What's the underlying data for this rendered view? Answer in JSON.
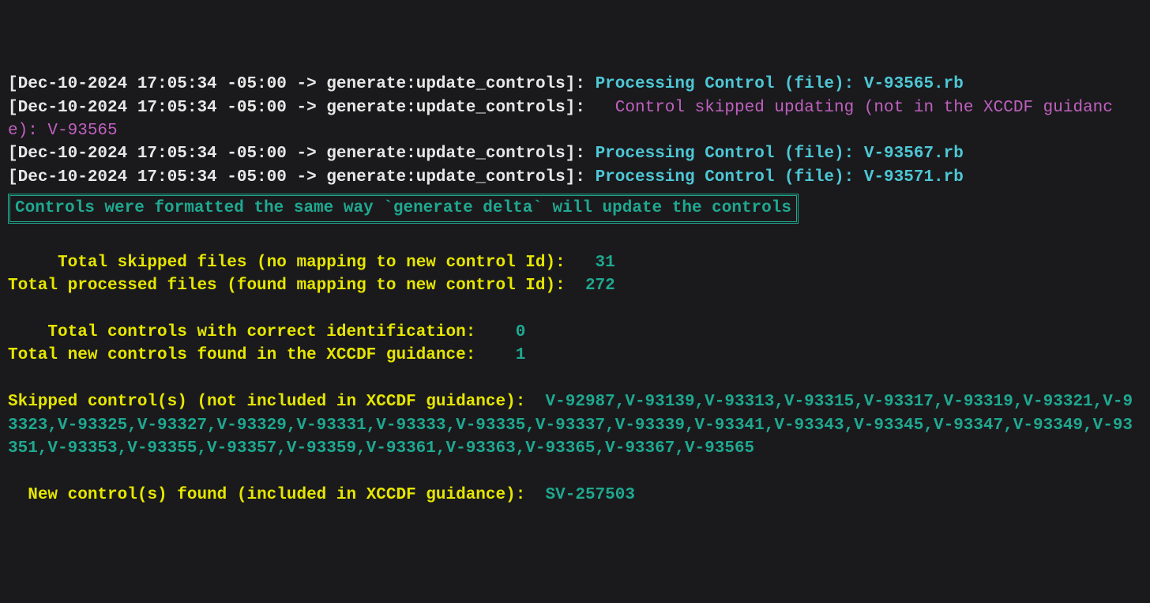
{
  "logs": [
    {
      "ts": "Dec-10-2024 17:05:34 -05:00",
      "prefix": "generate:update_controls",
      "type": "processing",
      "msg": "Processing Control (file):",
      "file": "V-93565.rb"
    },
    {
      "ts": "Dec-10-2024 17:05:34 -05:00",
      "prefix": "generate:update_controls",
      "type": "skipped",
      "msg": "Control skipped updating (not in the XCCDF guidance):",
      "id": "V-93565"
    },
    {
      "ts": "Dec-10-2024 17:05:34 -05:00",
      "prefix": "generate:update_controls",
      "type": "processing",
      "msg": "Processing Control (file):",
      "file": "V-93567.rb"
    },
    {
      "ts": "Dec-10-2024 17:05:34 -05:00",
      "prefix": "generate:update_controls",
      "type": "processing",
      "msg": "Processing Control (file):",
      "file": "V-93571.rb"
    }
  ],
  "box_message": "Controls were formatted the same way `generate delta` will update the controls",
  "summary": {
    "skipped_files_label": "Total skipped files (no mapping to new control Id):",
    "skipped_files_value": "31",
    "processed_files_label": "Total processed files (found mapping to new control Id):",
    "processed_files_value": "272",
    "correct_id_label": "Total controls with correct identification:",
    "correct_id_value": "0",
    "new_controls_label": "Total new controls found in the XCCDF guidance:",
    "new_controls_value": "1"
  },
  "skipped_controls": {
    "label": "Skipped control(s) (not included in XCCDF guidance):",
    "list": "V-92987,V-93139,V-93313,V-93315,V-93317,V-93319,V-93321,V-93323,V-93325,V-93327,V-93329,V-93331,V-93333,V-93335,V-93337,V-93339,V-93341,V-93343,V-93345,V-93347,V-93349,V-93351,V-93353,V-93355,V-93357,V-93359,V-93361,V-93363,V-93365,V-93367,V-93565"
  },
  "new_controls": {
    "label": "New control(s) found (included in XCCDF guidance):",
    "list": "SV-257503"
  }
}
